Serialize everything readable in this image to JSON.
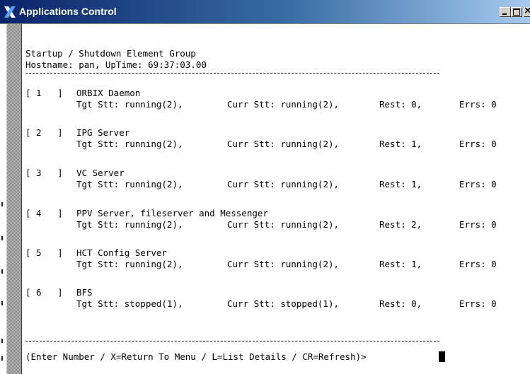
{
  "window": {
    "title": "Applications Control"
  },
  "terminal": {
    "heading": "Startup / Shutdown Element Group",
    "host_line": "Hostname: pan, UpTime: 69:37:03.00",
    "elements": [
      {
        "number": "[ 1   ]",
        "name": "ORBIX Daemon",
        "tgt": "Tgt Stt: running(2),",
        "curr": "Curr Stt: running(2),",
        "rest": "Rest: 0,",
        "errs": "Errs: 0"
      },
      {
        "number": "[ 2   ]",
        "name": "IPG Server",
        "tgt": "Tgt Stt: running(2),",
        "curr": "Curr Stt: running(2),",
        "rest": "Rest: 1,",
        "errs": "Errs: 0"
      },
      {
        "number": "[ 3   ]",
        "name": "VC Server",
        "tgt": "Tgt Stt: running(2),",
        "curr": "Curr Stt: running(2),",
        "rest": "Rest: 1,",
        "errs": "Errs: 0"
      },
      {
        "number": "[ 4   ]",
        "name": "PPV Server, fileserver and Messenger",
        "tgt": "Tgt Stt: running(2),",
        "curr": "Curr Stt: running(2),",
        "rest": "Rest: 2,",
        "errs": "Errs: 0"
      },
      {
        "number": "[ 5   ]",
        "name": "HCT Config Server",
        "tgt": "Tgt Stt: running(2),",
        "curr": "Curr Stt: running(2),",
        "rest": "Rest: 1,",
        "errs": "Errs: 0"
      },
      {
        "number": "[ 6   ]",
        "name": "BFS",
        "tgt": "Tgt Stt: stopped(1),",
        "curr": "Curr Stt: stopped(1),",
        "rest": "Rest: 0,",
        "errs": "Errs: 0"
      }
    ],
    "prompt": "(Enter Number / X=Return To Menu / L=List Details / CR=Refresh)>"
  }
}
